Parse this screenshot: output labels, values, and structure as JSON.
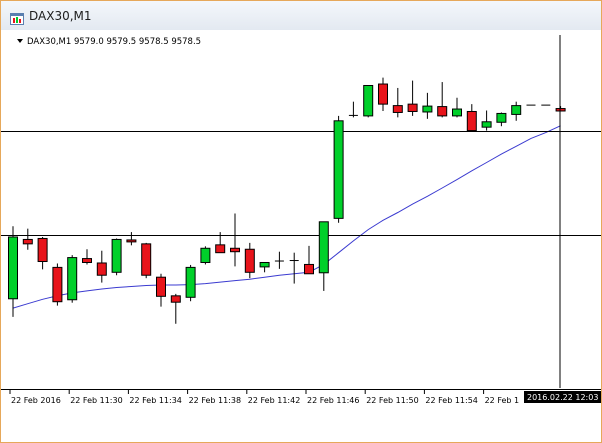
{
  "window": {
    "title": "DAX30,M1",
    "icon": "chart-window-icon"
  },
  "chart": {
    "header_text": "DAX30,M1  9579.0 9579.5 9578.5 9578.5",
    "crosshair_time_label": "2016.02.22 12:03",
    "colors": {
      "bull": "#00d02a",
      "bear": "#e8141b",
      "wick": "#000000",
      "ma": "#3b3bd0",
      "grid": "#000000",
      "time_label_bg": "#000000"
    }
  },
  "chart_data": {
    "type": "candlestick",
    "x_tick_labels": [
      "22 Feb 2016",
      "22 Feb 11:30",
      "22 Feb 11:34",
      "22 Feb 11:38",
      "22 Feb 11:42",
      "22 Feb 11:46",
      "22 Feb 11:50",
      "22 Feb 11:54",
      "22 Feb 1"
    ],
    "candle_count": 38,
    "series": [
      {
        "kind": "ohlc",
        "candles": [
          {
            "o": 9540.2,
            "h": 9555.0,
            "l": 9536.5,
            "c": 9552.8
          },
          {
            "o": 9552.3,
            "h": 9554.5,
            "l": 9550.2,
            "c": 9551.4
          },
          {
            "o": 9552.5,
            "h": 9552.8,
            "l": 9546.2,
            "c": 9547.8
          },
          {
            "o": 9546.6,
            "h": 9547.4,
            "l": 9538.8,
            "c": 9539.6
          },
          {
            "o": 9540.0,
            "h": 9549.1,
            "l": 9539.4,
            "c": 9548.6
          },
          {
            "o": 9548.4,
            "h": 9550.3,
            "l": 9547.2,
            "c": 9547.6
          },
          {
            "o": 9547.5,
            "h": 9550.0,
            "l": 9543.5,
            "c": 9545.0
          },
          {
            "o": 9545.6,
            "h": 9552.5,
            "l": 9545.0,
            "c": 9552.3
          },
          {
            "o": 9552.2,
            "h": 9553.8,
            "l": 9551.1,
            "c": 9551.8
          },
          {
            "o": 9551.4,
            "h": 9551.6,
            "l": 9544.4,
            "c": 9545.0
          },
          {
            "o": 9544.6,
            "h": 9545.3,
            "l": 9538.6,
            "c": 9540.7
          },
          {
            "o": 9540.8,
            "h": 9541.2,
            "l": 9535.1,
            "c": 9539.5
          },
          {
            "o": 9540.5,
            "h": 9547.1,
            "l": 9539.7,
            "c": 9546.6
          },
          {
            "o": 9547.6,
            "h": 9550.9,
            "l": 9547.2,
            "c": 9550.5
          },
          {
            "o": 9551.2,
            "h": 9553.8,
            "l": 9549.6,
            "c": 9549.6
          },
          {
            "o": 9550.5,
            "h": 9557.6,
            "l": 9546.8,
            "c": 9549.8
          },
          {
            "o": 9550.3,
            "h": 9551.6,
            "l": 9544.4,
            "c": 9545.6
          },
          {
            "o": 9546.7,
            "h": 9547.6,
            "l": 9545.6,
            "c": 9547.6
          },
          {
            "o": 9547.6,
            "h": 9549.8,
            "l": 9546.3,
            "c": 9547.9
          },
          {
            "o": 9547.9,
            "h": 9549.6,
            "l": 9543.3,
            "c": 9548.0
          },
          {
            "o": 9547.2,
            "h": 9551.0,
            "l": 9545.3,
            "c": 9545.3
          },
          {
            "o": 9545.5,
            "h": 9550.1,
            "l": 9541.8,
            "c": 9555.9
          },
          {
            "o": 9556.6,
            "h": 9577.5,
            "l": 9555.7,
            "c": 9576.5
          },
          {
            "o": 9577.5,
            "h": 9580.4,
            "l": 9577.2,
            "c": 9577.6
          },
          {
            "o": 9577.5,
            "h": 9583.7,
            "l": 9577.2,
            "c": 9583.7
          },
          {
            "o": 9584.0,
            "h": 9585.3,
            "l": 9578.5,
            "c": 9579.9
          },
          {
            "o": 9579.6,
            "h": 9583.2,
            "l": 9577.2,
            "c": 9578.2
          },
          {
            "o": 9579.9,
            "h": 9584.7,
            "l": 9577.5,
            "c": 9578.4
          },
          {
            "o": 9578.3,
            "h": 9582.2,
            "l": 9576.9,
            "c": 9579.5
          },
          {
            "o": 9579.4,
            "h": 9584.4,
            "l": 9577.2,
            "c": 9577.5
          },
          {
            "o": 9577.5,
            "h": 9581.2,
            "l": 9577.2,
            "c": 9578.9
          },
          {
            "o": 9578.4,
            "h": 9579.9,
            "l": 9576.5,
            "c": 9574.5
          },
          {
            "o": 9575.2,
            "h": 9578.6,
            "l": 9574.5,
            "c": 9576.3
          },
          {
            "o": 9576.2,
            "h": 9578.2,
            "l": 9575.4,
            "c": 9578.0
          },
          {
            "o": 9577.8,
            "h": 9580.4,
            "l": 9576.5,
            "c": 9579.6
          },
          {
            "o": 9579.7,
            "h": 9579.7,
            "l": 9579.7,
            "c": 9579.7
          },
          {
            "o": 9579.7,
            "h": 9579.7,
            "l": 9579.7,
            "c": 9579.7
          },
          {
            "o": 9579.0,
            "h": 9579.5,
            "l": 9578.5,
            "c": 9578.5
          }
        ]
      },
      {
        "kind": "moving_average",
        "values": [
          9538.3,
          9539.2,
          9540.1,
          9540.8,
          9541.4,
          9541.8,
          9542.2,
          9542.5,
          9542.7,
          9542.9,
          9543.0,
          9543.0,
          9543.1,
          9543.3,
          9543.6,
          9543.9,
          9544.2,
          9544.6,
          9545.0,
          9545.3,
          9545.6,
          9547.2,
          9549.6,
          9552.0,
          9554.3,
          9556.2,
          9557.8,
          9559.5,
          9561.1,
          9562.8,
          9564.5,
          9566.3,
          9568.0,
          9569.7,
          9571.3,
          9572.9,
          9574.1,
          9575.5
        ]
      }
    ],
    "horizontal_lines": [
      9574.5,
      9553.2
    ]
  }
}
